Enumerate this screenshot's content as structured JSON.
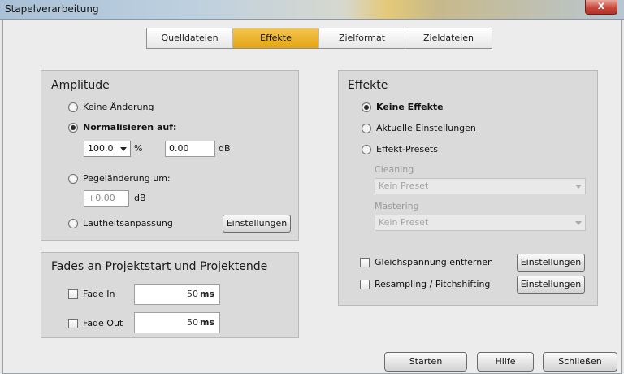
{
  "window": {
    "title": "Stapelverarbeitung",
    "close_label": "x"
  },
  "tabs": [
    {
      "label": "Quelldateien",
      "active": false
    },
    {
      "label": "Effekte",
      "active": true
    },
    {
      "label": "Zielformat",
      "active": false
    },
    {
      "label": "Zieldateien",
      "active": false
    }
  ],
  "amplitude": {
    "title": "Amplitude",
    "options": [
      {
        "label": "Keine Änderung",
        "checked": false
      },
      {
        "label": "Normalisieren auf:",
        "checked": true
      },
      {
        "label": "Pegeländerung um:",
        "checked": false
      },
      {
        "label": "Lautheitsanpassung",
        "checked": false
      }
    ],
    "normalize_value": "100.0",
    "normalize_unit": "%",
    "normalize_db": "0.00",
    "db_unit": "dB",
    "level_change_value": "+0.00",
    "settings_label": "Einstellungen"
  },
  "fades": {
    "title": "Fades an Projektstart und Projektende",
    "fade_in_label": "Fade In",
    "fade_in_value": "50",
    "fade_out_label": "Fade Out",
    "fade_out_value": "50",
    "unit": "ms"
  },
  "effects": {
    "title": "Effekte",
    "options": [
      {
        "label": "Keine Effekte",
        "checked": true
      },
      {
        "label": "Aktuelle Einstellungen",
        "checked": false
      },
      {
        "label": "Effekt-Presets",
        "checked": false
      }
    ],
    "cleaning_label": "Cleaning",
    "cleaning_value": "Kein Preset",
    "mastering_label": "Mastering",
    "mastering_value": "Kein Preset",
    "dc_label": "Gleichspannung entfernen",
    "resampling_label": "Resampling / Pitchshifting",
    "settings_label": "Einstellungen"
  },
  "footer": {
    "start_label": "Starten",
    "help_label": "Hilfe",
    "close_label": "Schließen"
  },
  "colors": {
    "active_tab": "#e8ad1f",
    "panel": "#dadada",
    "background": "#ececec"
  }
}
